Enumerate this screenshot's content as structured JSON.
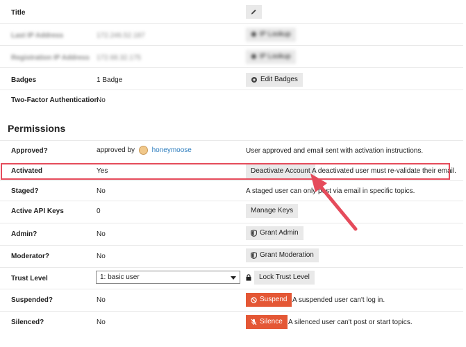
{
  "rows": {
    "title": {
      "label": "Title"
    },
    "last_ip": {
      "label": "Last IP Address",
      "value": "172.246.52.187",
      "button": "IP Lookup"
    },
    "reg_ip": {
      "label": "Registration IP Address",
      "value": "172.68.32.175",
      "button": "IP Lookup"
    },
    "badges": {
      "label": "Badges",
      "value": "1 Badge",
      "button": "Edit Badges"
    },
    "two_factor": {
      "label": "Two-Factor Authentication",
      "value": "No"
    }
  },
  "permissions": {
    "heading": "Permissions",
    "approved": {
      "label": "Approved?",
      "value_prefix": "approved by",
      "user": "honeymoose",
      "description": "User approved and email sent with activation instructions."
    },
    "activated": {
      "label": "Activated",
      "value": "Yes",
      "button": "Deactivate Account",
      "description": "A deactivated user must re-validate their email."
    },
    "staged": {
      "label": "Staged?",
      "value": "No",
      "description": "A staged user can only post via email in specific topics."
    },
    "api_keys": {
      "label": "Active API Keys",
      "value": "0",
      "button": "Manage Keys"
    },
    "admin": {
      "label": "Admin?",
      "value": "No",
      "button": "Grant Admin"
    },
    "moderator": {
      "label": "Moderator?",
      "value": "No",
      "button": "Grant Moderation"
    },
    "trust": {
      "label": "Trust Level",
      "selected": "1: basic user",
      "button": "Lock Trust Level"
    },
    "suspended": {
      "label": "Suspended?",
      "value": "No",
      "button": "Suspend",
      "description": "A suspended user can't log in."
    },
    "silenced": {
      "label": "Silenced?",
      "value": "No",
      "button": "Silence",
      "description": "A silenced user can't post or start topics."
    }
  },
  "colors": {
    "danger": "#e45735",
    "highlight": "#e54b5b",
    "arrow": "#e54b5b",
    "link": "#2a7bbd"
  }
}
